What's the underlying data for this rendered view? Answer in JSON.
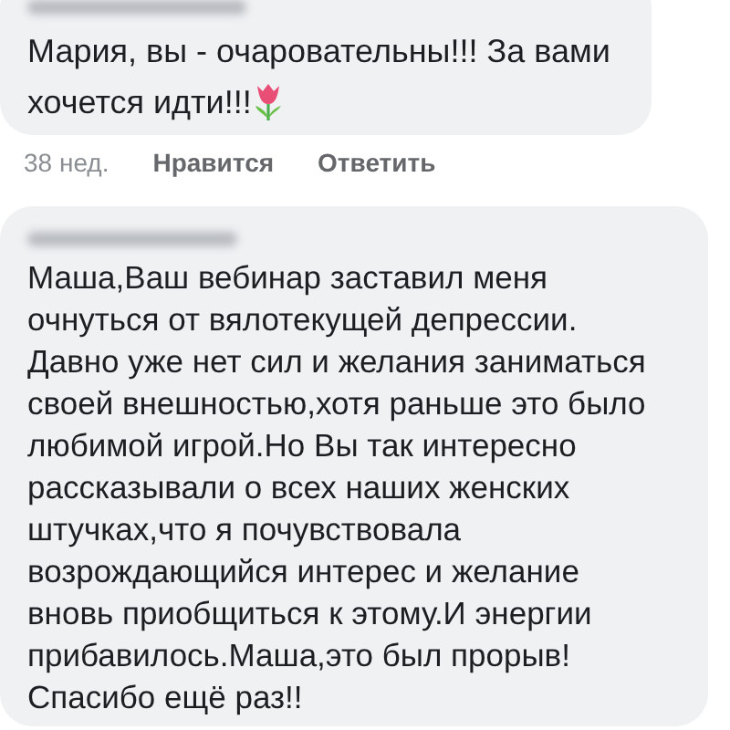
{
  "comments": [
    {
      "lines": [
        "Мария, вы -  очаровательны!!! За вами",
        "хочется идти!!!"
      ],
      "tulip_icon": true,
      "footer": {
        "time": "38 нед.",
        "like": "Нравится",
        "reply": "Ответить"
      }
    },
    {
      "lines": [
        "Маша,Ваш вебинар заставил меня",
        "очнуться от вялотекущей депрессии.",
        "Давно уже нет сил и желания заниматься",
        "своей внешностью,хотя раньше это было",
        "любимой игрой.Но Вы так интересно",
        "рассказывали о всех наших женских",
        "штучках,что я почувствовала",
        "возрождающийся интерес и желание",
        "вновь приобщиться к этому.И энергии",
        "прибавилось.Маша,это был прорыв!",
        "Спасибо ещё раз!!"
      ]
    }
  ]
}
